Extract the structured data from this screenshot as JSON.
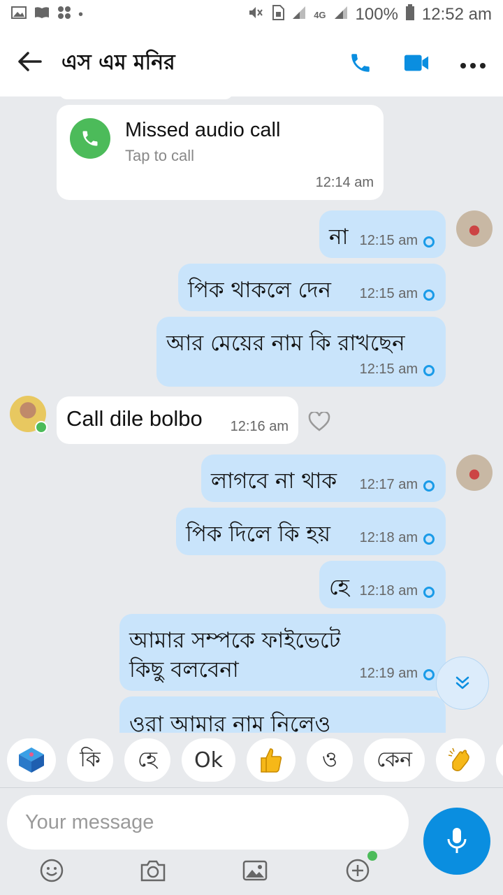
{
  "status_bar": {
    "battery": "100%",
    "time": "12:52 am",
    "network": "4G"
  },
  "header": {
    "contact_name": "এস এম মনির"
  },
  "colors": {
    "accent": "#0a8ee0",
    "outgoing_bubble": "#c9e4fb",
    "incoming_bubble": "#ffffff",
    "background": "#e8eaed",
    "missed_call_green": "#4cbb5a"
  },
  "missed_call": {
    "title": "Missed audio call",
    "subtitle": "Tap to call",
    "time": "12:14 am"
  },
  "messages": [
    {
      "text": "না",
      "time": "12:15 am"
    },
    {
      "text": "পিক থাকলে দেন",
      "time": "12:15 am"
    },
    {
      "text": "আর মেয়ের নাম কি রাখছেন",
      "time": "12:15 am"
    },
    {
      "text": "Call dile bolbo",
      "time": "12:16 am"
    },
    {
      "text": "লাগবে না থাক",
      "time": "12:17 am"
    },
    {
      "text": "পিক দিলে কি হয়",
      "time": "12:18 am"
    },
    {
      "text": "হে",
      "time": "12:18 am"
    },
    {
      "text_line1": "আমার সম্পকে ফাইভেটে",
      "text_line2": "কিছু বলবেনা",
      "time": "12:19 am"
    },
    {
      "text": "ওরা আমার নাম নিলেও"
    }
  ],
  "suggestions": [
    "কি",
    "হে",
    "Ok",
    "ও",
    "কেন"
  ],
  "composer": {
    "placeholder": "Your message"
  }
}
